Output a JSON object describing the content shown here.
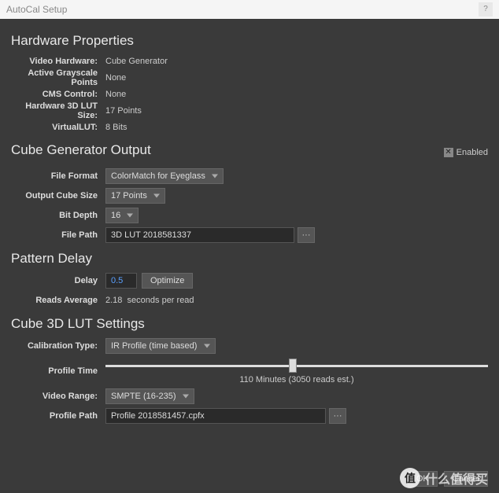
{
  "window": {
    "title": "AutoCal Setup"
  },
  "hardware": {
    "heading": "Hardware Properties",
    "rows": {
      "video_hardware": {
        "label": "Video Hardware:",
        "value": "Cube Generator"
      },
      "grayscale": {
        "label": "Active Grayscale Points",
        "value": "None"
      },
      "cms": {
        "label": "CMS Control:",
        "value": "None"
      },
      "lut_size": {
        "label": "Hardware 3D LUT Size:",
        "value": "17 Points"
      },
      "virtual_lut": {
        "label": "VirtualLUT:",
        "value": "8 Bits"
      }
    }
  },
  "output": {
    "heading": "Cube Generator Output",
    "enabled_label": "Enabled",
    "file_format": {
      "label": "File Format",
      "value": "ColorMatch for Eyeglass"
    },
    "cube_size": {
      "label": "Output Cube Size",
      "value": "17 Points"
    },
    "bit_depth": {
      "label": "Bit Depth",
      "value": "16"
    },
    "file_path": {
      "label": "File Path",
      "value": "3D LUT 2018581337"
    }
  },
  "pattern": {
    "heading": "Pattern Delay",
    "delay": {
      "label": "Delay",
      "value": "0.5",
      "optimize": "Optimize"
    },
    "reads": {
      "label": "Reads Average",
      "value": "2.18",
      "suffix": "seconds per read"
    }
  },
  "cube3d": {
    "heading": "Cube 3D LUT Settings",
    "calibration": {
      "label": "Calibration Type:",
      "value": "IR Profile (time based)"
    },
    "profile_time": {
      "label": "Profile Time",
      "caption": "110 Minutes (3050 reads est.)"
    },
    "video_range": {
      "label": "Video Range:",
      "value": "SMPTE (16-235)"
    },
    "profile_path": {
      "label": "Profile Path",
      "value": "Profile 2018581457.cpfx"
    }
  },
  "buttons": {
    "ok": "OK",
    "cancel": "Cancel"
  },
  "watermark": {
    "text": "什么值得买",
    "badge": "值"
  }
}
